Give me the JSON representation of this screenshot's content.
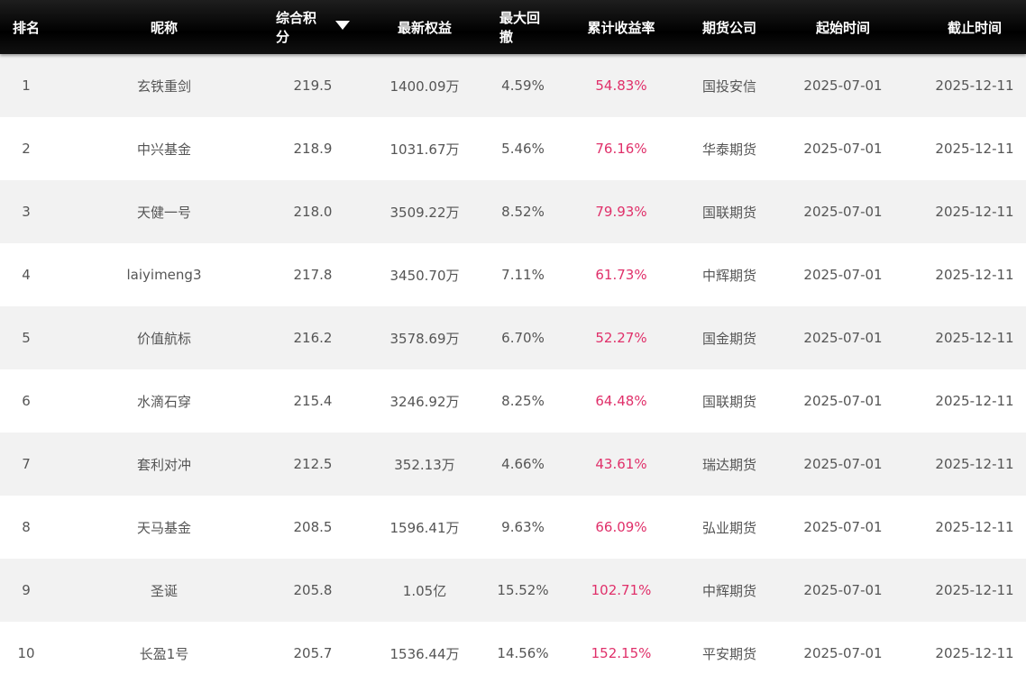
{
  "header": {
    "rank": "排名",
    "nickname": "昵称",
    "score": "综合积分",
    "equity": "最新权益",
    "drawdown": "最大回撤",
    "return": "累计收益率",
    "company": "期货公司",
    "start": "起始时间",
    "end": "截止时间"
  },
  "colors": {
    "header_bg": "#000000",
    "return_text": "#e0306a",
    "row_alt": "#f2f2f2"
  },
  "rows": [
    {
      "rank": "1",
      "nickname": "玄铁重剑",
      "score": "219.5",
      "equity": "1400.09万",
      "drawdown": "4.59%",
      "return": "54.83%",
      "company": "国投安信",
      "start": "2025-07-01",
      "end": "2025-12-11"
    },
    {
      "rank": "2",
      "nickname": "中兴基金",
      "score": "218.9",
      "equity": "1031.67万",
      "drawdown": "5.46%",
      "return": "76.16%",
      "company": "华泰期货",
      "start": "2025-07-01",
      "end": "2025-12-11"
    },
    {
      "rank": "3",
      "nickname": "天健一号",
      "score": "218.0",
      "equity": "3509.22万",
      "drawdown": "8.52%",
      "return": "79.93%",
      "company": "国联期货",
      "start": "2025-07-01",
      "end": "2025-12-11"
    },
    {
      "rank": "4",
      "nickname": "laiyimeng3",
      "score": "217.8",
      "equity": "3450.70万",
      "drawdown": "7.11%",
      "return": "61.73%",
      "company": "中辉期货",
      "start": "2025-07-01",
      "end": "2025-12-11"
    },
    {
      "rank": "5",
      "nickname": "价值航标",
      "score": "216.2",
      "equity": "3578.69万",
      "drawdown": "6.70%",
      "return": "52.27%",
      "company": "国金期货",
      "start": "2025-07-01",
      "end": "2025-12-11"
    },
    {
      "rank": "6",
      "nickname": "水滴石穿",
      "score": "215.4",
      "equity": "3246.92万",
      "drawdown": "8.25%",
      "return": "64.48%",
      "company": "国联期货",
      "start": "2025-07-01",
      "end": "2025-12-11"
    },
    {
      "rank": "7",
      "nickname": "套利对冲",
      "score": "212.5",
      "equity": "352.13万",
      "drawdown": "4.66%",
      "return": "43.61%",
      "company": "瑞达期货",
      "start": "2025-07-01",
      "end": "2025-12-11"
    },
    {
      "rank": "8",
      "nickname": "天马基金",
      "score": "208.5",
      "equity": "1596.41万",
      "drawdown": "9.63%",
      "return": "66.09%",
      "company": "弘业期货",
      "start": "2025-07-01",
      "end": "2025-12-11"
    },
    {
      "rank": "9",
      "nickname": "圣诞",
      "score": "205.8",
      "equity": "1.05亿",
      "drawdown": "15.52%",
      "return": "102.71%",
      "company": "中辉期货",
      "start": "2025-07-01",
      "end": "2025-12-11"
    },
    {
      "rank": "10",
      "nickname": "长盈1号",
      "score": "205.7",
      "equity": "1536.44万",
      "drawdown": "14.56%",
      "return": "152.15%",
      "company": "平安期货",
      "start": "2025-07-01",
      "end": "2025-12-11"
    }
  ]
}
